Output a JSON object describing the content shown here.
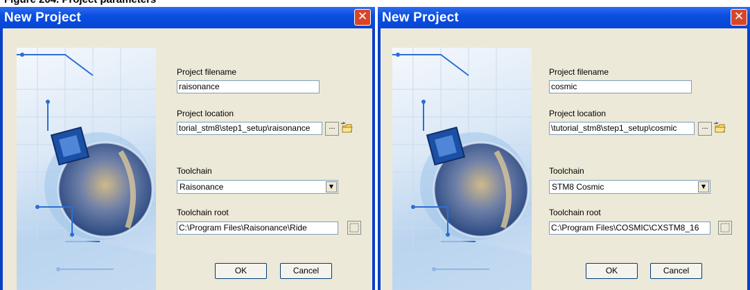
{
  "caption": "Figure 204. Project parameters",
  "dialogs": [
    {
      "title": "New Project",
      "close_glyph": "✕",
      "project_filename_label": "Project filename",
      "project_filename_value": "raisonance",
      "project_location_label": "Project location",
      "project_location_value": "torial_stm8\\step1_setup\\raisonance",
      "browse_label": "...",
      "toolchain_label": "Toolchain",
      "toolchain_value": "Raisonance",
      "toolchain_root_label": "Toolchain root",
      "toolchain_root_value": "C:\\Program Files\\Raisonance\\Ride",
      "ok_label": "OK",
      "cancel_label": "Cancel"
    },
    {
      "title": "New Project",
      "close_glyph": "✕",
      "project_filename_label": "Project filename",
      "project_filename_value": "cosmic",
      "project_location_label": "Project location",
      "project_location_value": "\\tutorial_stm8\\step1_setup\\cosmic",
      "browse_label": "...",
      "toolchain_label": "Toolchain",
      "toolchain_value": "STM8 Cosmic",
      "toolchain_root_label": "Toolchain root",
      "toolchain_root_value": "C:\\Program Files\\COSMIC\\CXSTM8_16",
      "ok_label": "OK",
      "cancel_label": "Cancel"
    }
  ],
  "icons": {
    "close": "close-icon",
    "new_folder": "new-folder-icon",
    "dropdown": "chevron-down-icon",
    "browse": "browse-icon"
  },
  "colors": {
    "titlebar": "#0846d6",
    "dialog_face": "#ece9d8",
    "close_button": "#d8462a"
  }
}
